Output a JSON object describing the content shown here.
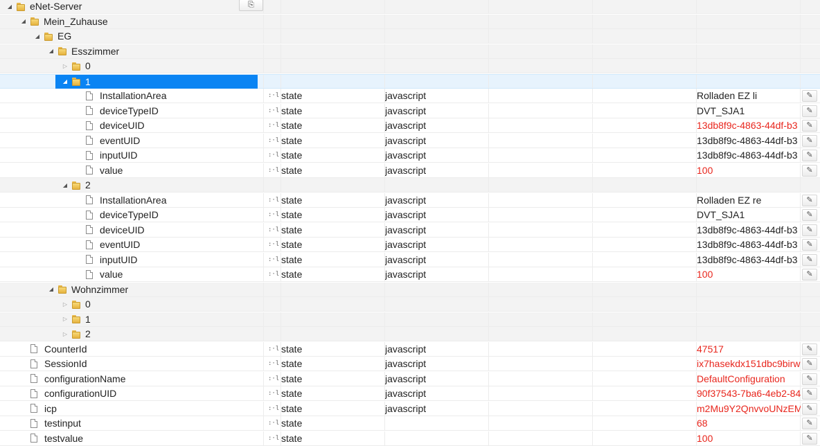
{
  "colors": {
    "selection": "#0a84f3",
    "value_red": "#e8261d",
    "row_grey": "#f3f3f3"
  },
  "toolbar": {
    "clipboard_icon": "clipboard-icon",
    "clipboard_glyph": "⎘"
  },
  "edit_glyph": "✎",
  "role_glyph": ":·l",
  "rows": [
    {
      "kind": "folder",
      "indent": 0,
      "expanded": true,
      "label": "eNet-Server"
    },
    {
      "kind": "folder",
      "indent": 1,
      "expanded": true,
      "label": "Mein_Zuhause"
    },
    {
      "kind": "folder",
      "indent": 2,
      "expanded": true,
      "label": "EG"
    },
    {
      "kind": "folder",
      "indent": 3,
      "expanded": true,
      "label": "Esszimmer"
    },
    {
      "kind": "folder",
      "indent": 4,
      "expanded": false,
      "label": "0"
    },
    {
      "kind": "folder",
      "indent": 4,
      "expanded": true,
      "label": "1",
      "selected": true
    },
    {
      "kind": "state",
      "indent": 5,
      "label": "InstallationArea",
      "type": "state",
      "role": "javascript",
      "value": "Rolladen EZ li",
      "red": false
    },
    {
      "kind": "state",
      "indent": 5,
      "label": "deviceTypeID",
      "type": "state",
      "role": "javascript",
      "value": "DVT_SJA1",
      "red": false
    },
    {
      "kind": "state",
      "indent": 5,
      "label": "deviceUID",
      "type": "state",
      "role": "javascript",
      "value": "13db8f9c-4863-44df-b3",
      "red": true
    },
    {
      "kind": "state",
      "indent": 5,
      "label": "eventUID",
      "type": "state",
      "role": "javascript",
      "value": "13db8f9c-4863-44df-b3",
      "red": false
    },
    {
      "kind": "state",
      "indent": 5,
      "label": "inputUID",
      "type": "state",
      "role": "javascript",
      "value": "13db8f9c-4863-44df-b3",
      "red": false
    },
    {
      "kind": "state",
      "indent": 5,
      "label": "value",
      "type": "state",
      "role": "javascript",
      "value": "100",
      "red": true
    },
    {
      "kind": "folder",
      "indent": 4,
      "expanded": true,
      "label": "2"
    },
    {
      "kind": "state",
      "indent": 5,
      "label": "InstallationArea",
      "type": "state",
      "role": "javascript",
      "value": "Rolladen EZ re",
      "red": false
    },
    {
      "kind": "state",
      "indent": 5,
      "label": "deviceTypeID",
      "type": "state",
      "role": "javascript",
      "value": "DVT_SJA1",
      "red": false
    },
    {
      "kind": "state",
      "indent": 5,
      "label": "deviceUID",
      "type": "state",
      "role": "javascript",
      "value": "13db8f9c-4863-44df-b3",
      "red": false
    },
    {
      "kind": "state",
      "indent": 5,
      "label": "eventUID",
      "type": "state",
      "role": "javascript",
      "value": "13db8f9c-4863-44df-b3",
      "red": false
    },
    {
      "kind": "state",
      "indent": 5,
      "label": "inputUID",
      "type": "state",
      "role": "javascript",
      "value": "13db8f9c-4863-44df-b3",
      "red": false
    },
    {
      "kind": "state",
      "indent": 5,
      "label": "value",
      "type": "state",
      "role": "javascript",
      "value": "100",
      "red": true
    },
    {
      "kind": "folder",
      "indent": 3,
      "expanded": true,
      "label": "Wohnzimmer"
    },
    {
      "kind": "folder",
      "indent": 4,
      "expanded": false,
      "label": "0"
    },
    {
      "kind": "folder",
      "indent": 4,
      "expanded": false,
      "label": "1"
    },
    {
      "kind": "folder",
      "indent": 4,
      "expanded": false,
      "label": "2"
    },
    {
      "kind": "state",
      "indent": 1,
      "label": "CounterId",
      "type": "state",
      "role": "javascript",
      "value": "47517",
      "red": true
    },
    {
      "kind": "state",
      "indent": 1,
      "label": "SessionId",
      "type": "state",
      "role": "javascript",
      "value": "ix7hasekdx151dbc9birw",
      "red": true
    },
    {
      "kind": "state",
      "indent": 1,
      "label": "configurationName",
      "type": "state",
      "role": "javascript",
      "value": "DefaultConfiguration",
      "red": true
    },
    {
      "kind": "state",
      "indent": 1,
      "label": "configurationUID",
      "type": "state",
      "role": "javascript",
      "value": "90f37543-7ba6-4eb2-84",
      "red": true
    },
    {
      "kind": "state",
      "indent": 1,
      "label": "icp",
      "type": "state",
      "role": "javascript",
      "value": "m2Mu9Y2QnvvoUNzEM",
      "red": true
    },
    {
      "kind": "state",
      "indent": 1,
      "label": "testinput",
      "type": "state",
      "role": "",
      "value": "68",
      "red": true
    },
    {
      "kind": "state",
      "indent": 1,
      "label": "testvalue",
      "type": "state",
      "role": "",
      "value": "100",
      "red": true
    }
  ]
}
